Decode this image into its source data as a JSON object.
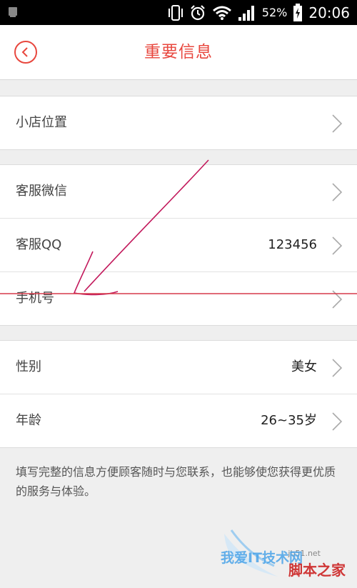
{
  "status_bar": {
    "battery": "52%",
    "time": "20:06"
  },
  "header": {
    "title": "重要信息"
  },
  "groups": [
    {
      "rows": [
        {
          "label": "小店位置",
          "value": ""
        }
      ]
    },
    {
      "rows": [
        {
          "label": "客服微信",
          "value": ""
        },
        {
          "label": "客服QQ",
          "value": "123456"
        },
        {
          "label": "手机号",
          "value": ""
        }
      ]
    },
    {
      "rows": [
        {
          "label": "性别",
          "value": "美女"
        },
        {
          "label": "年龄",
          "value": "26~35岁"
        }
      ]
    }
  ],
  "footer": {
    "note": "填写完整的信息方便顾客随时与您联系，也能够使您获得更优质的服务与体验。"
  },
  "watermark": {
    "line1": "我爱IT技术网",
    "line2": "脚本之家",
    "line3": "jb51.net"
  },
  "colors": {
    "accent": "#e8473e",
    "annotation": "#c2185b"
  }
}
